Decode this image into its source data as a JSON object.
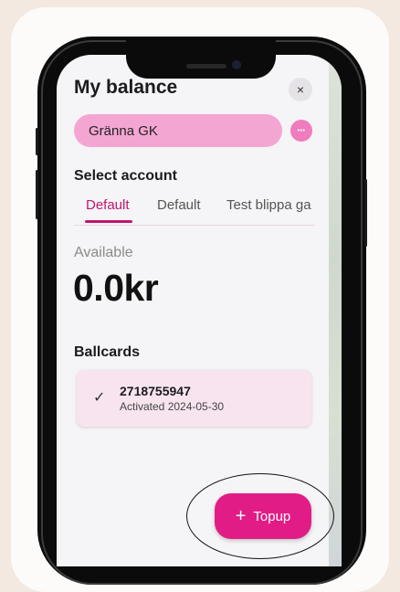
{
  "header": {
    "title": "My balance",
    "close_icon": "×"
  },
  "club": {
    "name": "Gränna GK",
    "more_icon": "•••"
  },
  "account": {
    "section_label": "Select account",
    "tabs": [
      {
        "label": "Default",
        "selected": true
      },
      {
        "label": "Default",
        "selected": false
      },
      {
        "label": "Test blippa ga",
        "selected": false
      }
    ]
  },
  "balance": {
    "label": "Available",
    "amount": "0.0kr"
  },
  "ballcards": {
    "section_label": "Ballcards",
    "items": [
      {
        "check_icon": "✓",
        "number": "2718755947",
        "activated": "Activated 2024-05-30"
      }
    ]
  },
  "fab": {
    "plus_icon": "+",
    "label": "Topup"
  },
  "colors": {
    "accent": "#c0166f",
    "club_pill": "#f4a6d3",
    "topup_button": "#e21c86",
    "background": "#f3e9e1"
  }
}
